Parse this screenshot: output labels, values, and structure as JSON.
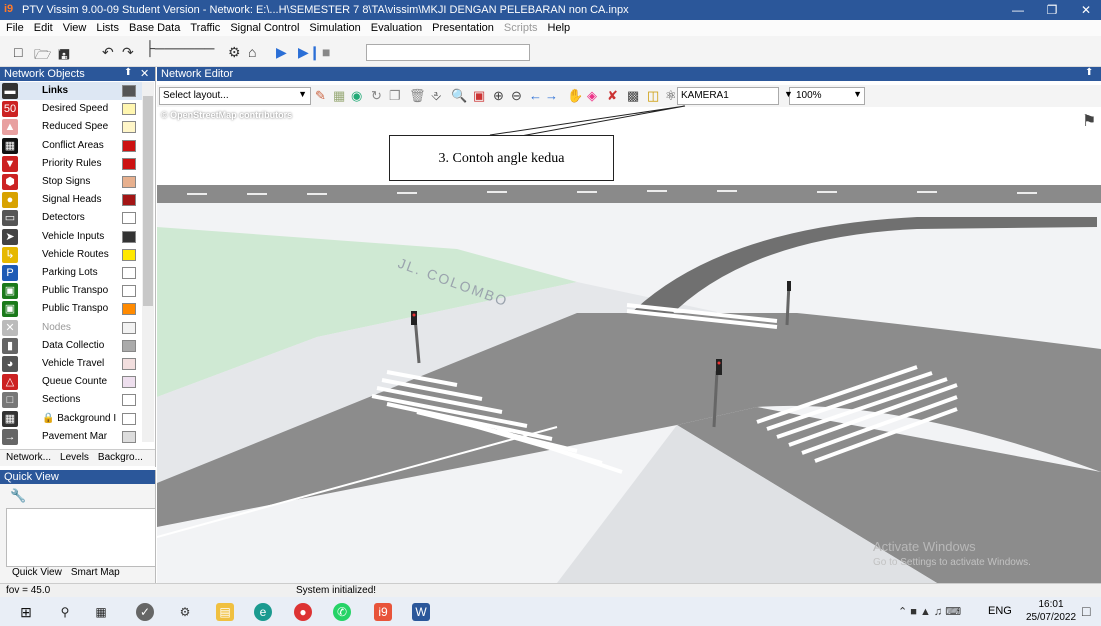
{
  "window": {
    "title": "PTV Vissim 9.00-09 Student Version - Network: E:\\...H\\SEMESTER 7 8\\TA\\vissim\\MKJI DENGAN PELEBARAN non CA.inpx",
    "app_icon_text": "i9"
  },
  "menu": [
    "File",
    "Edit",
    "View",
    "Lists",
    "Base Data",
    "Traffic",
    "Signal Control",
    "Simulation",
    "Evaluation",
    "Presentation",
    "Scripts",
    "Help"
  ],
  "network_objects": {
    "title": "Network Objects",
    "items": [
      {
        "label": "Links",
        "icon": "links-icon",
        "color": "#333333",
        "swatch": "#555555"
      },
      {
        "label": "Desired Speed",
        "icon": "speed-limit-icon",
        "color": "#cc2222",
        "swatch": "#fff6b0"
      },
      {
        "label": "Reduced Spee",
        "icon": "reduced-speed-icon",
        "color": "#e8a0a0",
        "swatch": "#fff6c8"
      },
      {
        "label": "Conflict Areas",
        "icon": "conflict-area-icon",
        "color": "#111111",
        "swatch": "#cc1111"
      },
      {
        "label": "Priority Rules",
        "icon": "priority-rule-icon",
        "color": "#cc2222",
        "swatch": "#cc1111"
      },
      {
        "label": "Stop Signs",
        "icon": "stop-sign-icon",
        "color": "#cc2222",
        "swatch": "#e7b08e"
      },
      {
        "label": "Signal Heads",
        "icon": "signal-head-icon",
        "color": "#d8a200",
        "swatch": "#a31515"
      },
      {
        "label": "Detectors",
        "icon": "detector-icon",
        "color": "#555555",
        "swatch": "#ffffff"
      },
      {
        "label": "Vehicle Inputs",
        "icon": "vehicle-input-icon",
        "color": "#444444",
        "swatch": "#333333"
      },
      {
        "label": "Vehicle Routes",
        "icon": "vehicle-route-icon",
        "color": "#e6b800",
        "swatch": "#ffe800"
      },
      {
        "label": "Parking Lots",
        "icon": "parking-icon",
        "color": "#1e5bb5",
        "swatch": "#ffffff"
      },
      {
        "label": "Public Transpo",
        "icon": "pt-stop-icon",
        "color": "#1b7a1b",
        "swatch": "#ffffff"
      },
      {
        "label": "Public Transpo",
        "icon": "pt-line-icon",
        "color": "#1b7a1b",
        "swatch": "#ff8a00"
      },
      {
        "label": "Nodes",
        "icon": "nodes-icon",
        "color": "#bbbbbb",
        "swatch": "#f2f2f2"
      },
      {
        "label": "Data Collectio",
        "icon": "data-collection-icon",
        "color": "#666666",
        "swatch": "#aaaaaa"
      },
      {
        "label": "Vehicle Travel",
        "icon": "vehicle-travel-icon",
        "color": "#555555",
        "swatch": "#f2dede"
      },
      {
        "label": "Queue Counte",
        "icon": "queue-counter-icon",
        "color": "#cc2222",
        "swatch": "#eedfee"
      },
      {
        "label": "Sections",
        "icon": "sections-icon",
        "color": "#777777",
        "swatch": "#ffffff"
      },
      {
        "label": "Background I",
        "icon": "background-image-icon",
        "color": "#333333",
        "swatch": "#ffffff",
        "locked": true
      },
      {
        "label": "Pavement Mar",
        "icon": "pavement-marking-icon",
        "color": "#666666",
        "swatch": "#dddddd"
      }
    ],
    "tabs": [
      "Network...",
      "Levels",
      "Backgro..."
    ]
  },
  "quick_view": {
    "title": "Quick View",
    "tabs": [
      "Quick View",
      "Smart Map"
    ]
  },
  "editor": {
    "title": "Network Editor",
    "layout_placeholder": "Select layout...",
    "camera": "KAMERA1",
    "zoom": "100%",
    "attribution": "© OpenStreetMap contributors",
    "callout": "3. Contoh angle kedua",
    "watermark_title": "Activate Windows",
    "watermark_sub": "Go to Settings to activate Windows."
  },
  "status": {
    "fov": "fov = 45.0",
    "message": "System initialized!"
  },
  "taskbar": {
    "lang": "ENG",
    "time": "16:01",
    "date": "25/07/2022"
  }
}
